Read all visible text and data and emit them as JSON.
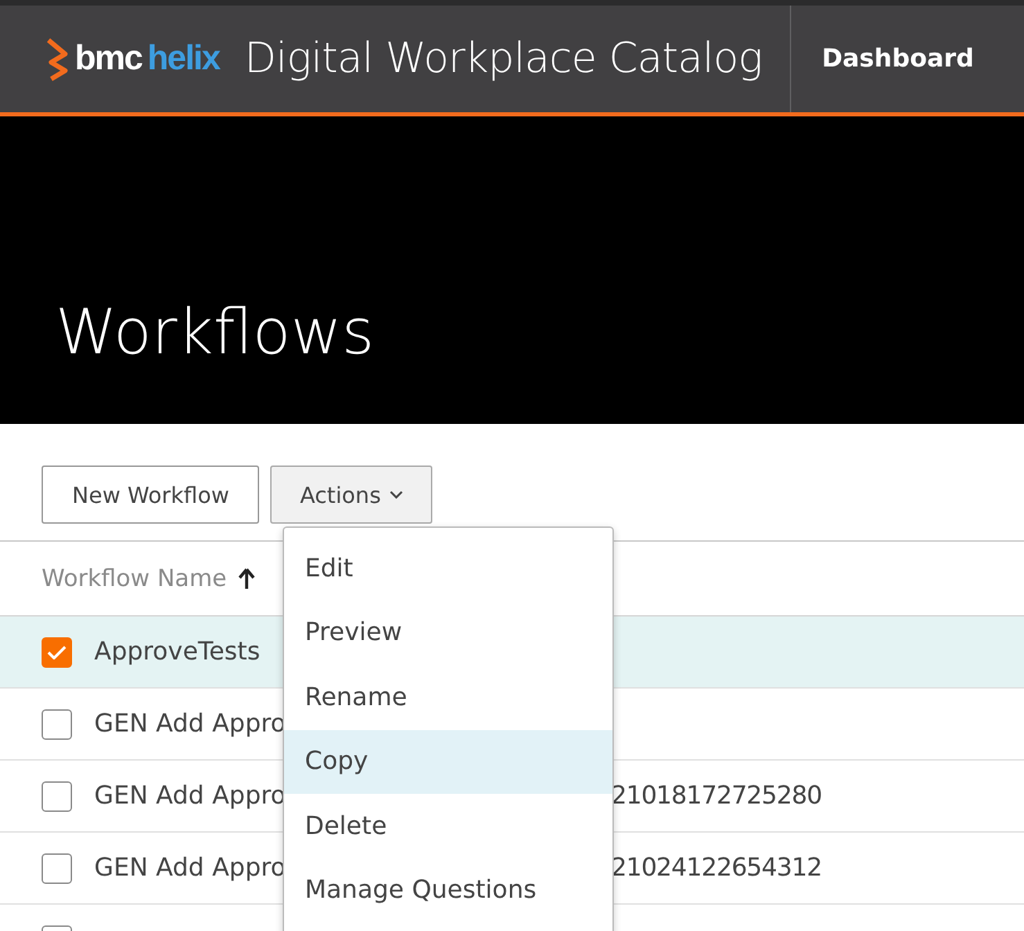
{
  "header": {
    "logo_brand": "bmc",
    "logo_product": "helix",
    "app_title": "Digital Workplace Catalog",
    "nav": [
      {
        "label": "Dashboard",
        "selected": false
      }
    ]
  },
  "page_title": "Workflows",
  "toolbar": {
    "buttons": [
      {
        "label": "New Workflow",
        "kind": "plain"
      },
      {
        "label": "Actions",
        "kind": "dropdown"
      }
    ]
  },
  "table": {
    "columns": [
      {
        "label": "Workflow Name",
        "sorted_ascending": true
      }
    ],
    "rows": [
      {
        "name": "ApproveTests",
        "selected": true
      },
      {
        "name": "GEN Add Appro",
        "selected": false
      },
      {
        "name": "GEN Add Appro",
        "tail": "21018172725280",
        "selected": false
      },
      {
        "name": "GEN Add Appro",
        "tail": "21024122654312",
        "selected": false
      },
      {
        "selected": false
      }
    ]
  },
  "actions_menu": {
    "items": [
      {
        "label": "Edit",
        "selected": false
      },
      {
        "label": "Preview",
        "selected": false
      },
      {
        "label": "Rename",
        "selected": false
      },
      {
        "label": "Copy",
        "selected": true
      },
      {
        "label": "Delete",
        "selected": false
      },
      {
        "label": "Manage Questions",
        "selected": false
      }
    ]
  }
}
